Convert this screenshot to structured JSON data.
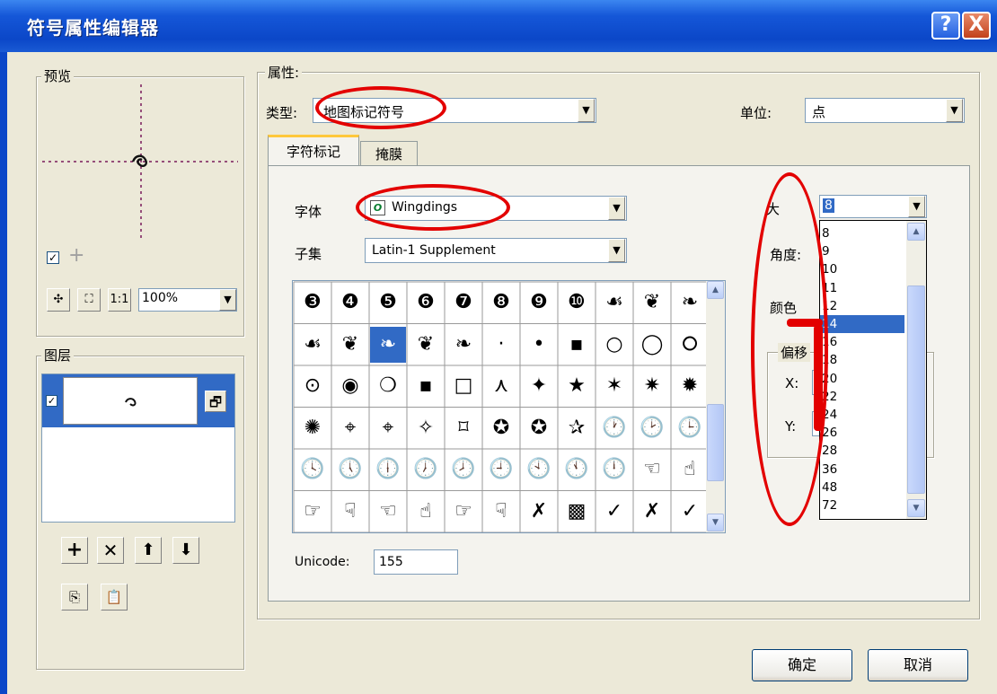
{
  "window": {
    "title": "符号属性编辑器",
    "help": "?",
    "close": "X"
  },
  "preview": {
    "legend": "预览",
    "zoom_value": "100%"
  },
  "layers": {
    "legend": "图层"
  },
  "properties": {
    "legend": "属性:",
    "type_label": "类型:",
    "type_value": "地图标记符号",
    "unit_label": "单位:",
    "unit_value": "点",
    "tabs": [
      {
        "label": "字符标记"
      },
      {
        "label": "掩膜"
      }
    ],
    "font_label": "字体",
    "font_value": "Wingdings",
    "subset_label": "子集",
    "subset_value": "Latin-1 Supplement",
    "size_label": "大",
    "size_value": "8",
    "angle_label": "角度:",
    "color_label": "颜色",
    "offset_label": "偏移",
    "x_label": "X:",
    "y_label": "Y:",
    "unicode_label": "Unicode:",
    "unicode_value": "155",
    "size_options": [
      "8",
      "9",
      "10",
      "11",
      "12",
      "14",
      "16",
      "18",
      "20",
      "22",
      "24",
      "26",
      "28",
      "36",
      "48",
      "72"
    ],
    "size_selected": "14"
  },
  "glyph_grid": {
    "selected_index": 13,
    "glyphs": [
      "❸",
      "❹",
      "❺",
      "❻",
      "❼",
      "❽",
      "❾",
      "❿",
      "☙",
      "❦",
      "❧",
      "☙",
      "❦",
      "❧",
      "❦",
      "❧",
      "·",
      "•",
      "▪",
      "○",
      "◯",
      "⭘",
      "⊙",
      "◉",
      "❍",
      "▪",
      "□",
      "⋏",
      "✦",
      "★",
      "✶",
      "✷",
      "✹",
      "✺",
      "⌖",
      "⌖",
      "✧",
      "⌑",
      "✪",
      "✪",
      "✰",
      "🕐",
      "🕑",
      "🕒",
      "🕓",
      "🕔",
      "🕕",
      "🕖",
      "🕗",
      "🕘",
      "🕙",
      "🕚",
      "🕛",
      "☜",
      "☝",
      "☞",
      "☟",
      "☜",
      "☝",
      "☞",
      "☟",
      "✗",
      "▩",
      "✓",
      "✗",
      "✓"
    ]
  },
  "buttons": {
    "ok": "确定",
    "cancel": "取消"
  },
  "colors": {
    "titlebar": "#0B47C8",
    "selection": "#316AC5",
    "annotation": "#E30000",
    "face": "#ECE9D8"
  }
}
